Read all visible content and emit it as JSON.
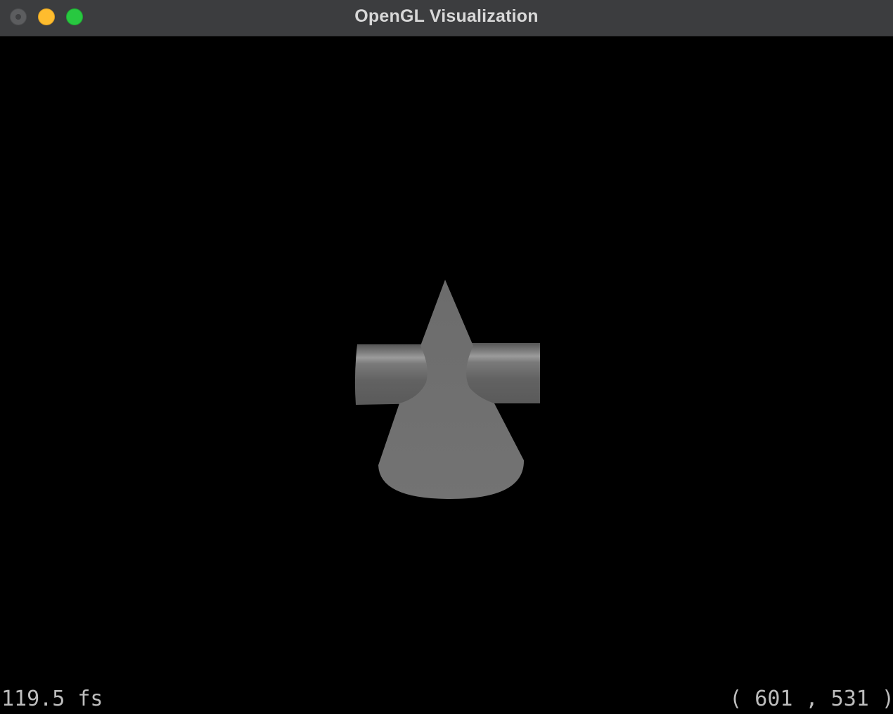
{
  "window": {
    "title": "OpenGL Visualization"
  },
  "titlebar": {
    "buttons": [
      {
        "name": "close",
        "color": "#5c5d5f"
      },
      {
        "name": "minimize",
        "color": "#febc2e"
      },
      {
        "name": "maximize",
        "color": "#28c840"
      }
    ]
  },
  "viewport": {
    "background": "#000000",
    "objects": [
      {
        "name": "horizontal-cylinder",
        "color": "#6a6a6a"
      },
      {
        "name": "cone",
        "color": "#727272"
      }
    ],
    "hud": {
      "frame_rate": "119.5 fs",
      "cursor_coords": "( 601 , 531 )"
    }
  }
}
